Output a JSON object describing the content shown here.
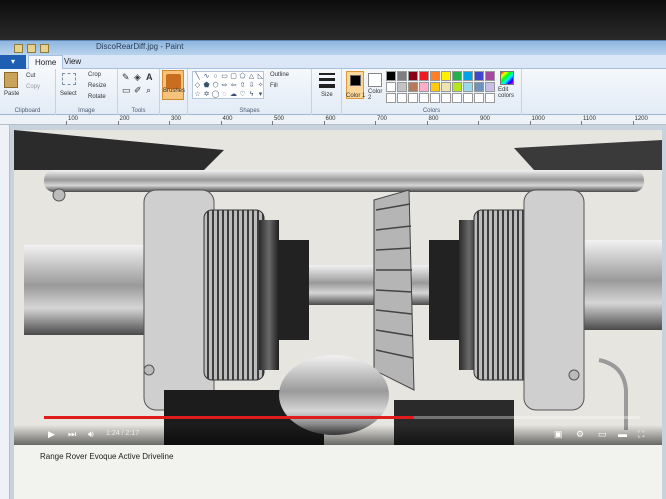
{
  "window": {
    "title": "DiscoRearDiff.jpg - Paint"
  },
  "tabs": [
    {
      "label": "Home"
    },
    {
      "label": "View"
    }
  ],
  "ribbon": {
    "clipboard": {
      "paste": "Paste",
      "cut": "Cut",
      "copy": "Copy",
      "group": "Clipboard"
    },
    "image": {
      "select": "Select",
      "crop": "Crop",
      "resize": "Resize",
      "rotate": "Rotate",
      "group": "Image"
    },
    "tools": {
      "group": "Tools"
    },
    "brushes": {
      "label": "Brushes"
    },
    "shapes": {
      "outline": "Outline",
      "fill": "Fill",
      "group": "Shapes"
    },
    "size": {
      "label": "Size"
    },
    "colors": {
      "color1": "Color 1",
      "color2": "Color 2",
      "edit": "Edit colors",
      "group": "Colors",
      "palette": [
        "#000000",
        "#7f7f7f",
        "#880015",
        "#ed1c24",
        "#ff7f27",
        "#fff200",
        "#22b14c",
        "#00a2e8",
        "#3f48cc",
        "#a349a4",
        "#ffffff",
        "#c3c3c3",
        "#b97a57",
        "#ffaec9",
        "#ffc90e",
        "#efe4b0",
        "#b5e61d",
        "#99d9ea",
        "#7092be",
        "#c8bfe7",
        "#ffffff",
        "#ffffff",
        "#ffffff",
        "#ffffff",
        "#ffffff",
        "#ffffff",
        "#ffffff",
        "#ffffff",
        "#ffffff",
        "#ffffff"
      ]
    }
  },
  "ruler": {
    "labels": [
      "100",
      "200",
      "300",
      "400",
      "500",
      "600",
      "700",
      "800",
      "900",
      "1000",
      "1100",
      "1200"
    ]
  },
  "video": {
    "time": "1:24 / 2:17",
    "progress": 0.62
  },
  "caption": "Range Rover Evoque Active Driveline"
}
